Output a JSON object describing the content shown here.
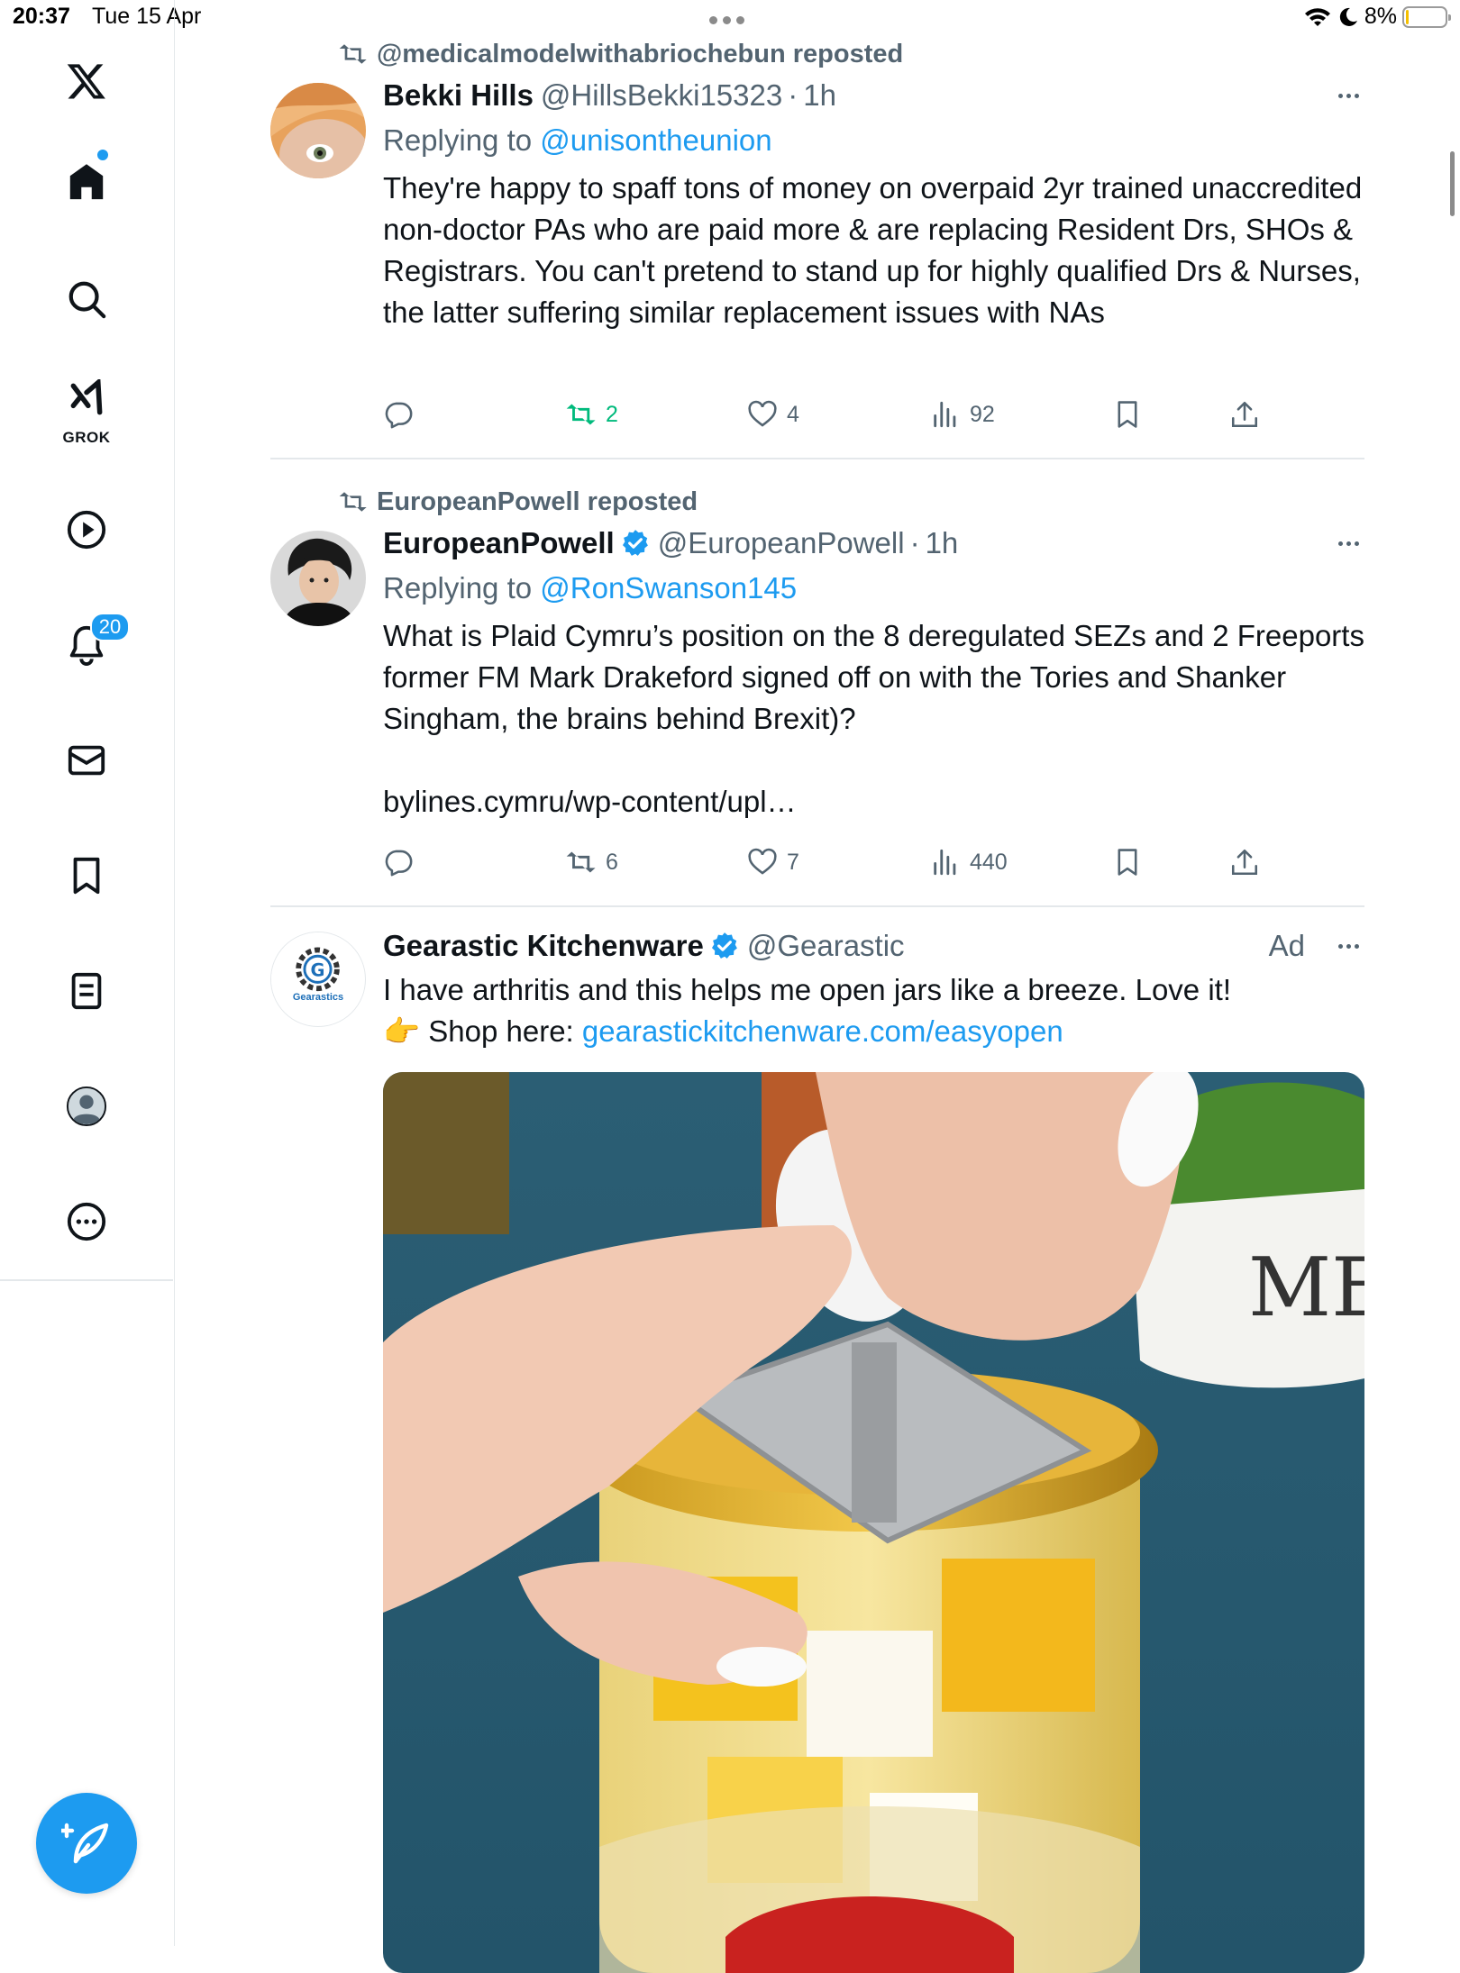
{
  "status_bar": {
    "time": "20:37",
    "date": "Tue 15 Apr",
    "battery_pct": "8%",
    "battery_level": 0.08
  },
  "sidebar": {
    "items": [
      {
        "id": "x-logo",
        "icon": "x-logo-icon"
      },
      {
        "id": "home",
        "icon": "home-icon",
        "has_dot": true
      },
      {
        "id": "search",
        "icon": "search-icon"
      },
      {
        "id": "grok",
        "icon": "grok-icon",
        "label": "GROK"
      },
      {
        "id": "video",
        "icon": "play-icon"
      },
      {
        "id": "notifications",
        "icon": "bell-icon",
        "badge": "20"
      },
      {
        "id": "messages",
        "icon": "mail-icon"
      },
      {
        "id": "bookmarks",
        "icon": "bookmark-icon"
      },
      {
        "id": "lists",
        "icon": "list-icon"
      },
      {
        "id": "profile",
        "icon": "profile-icon"
      },
      {
        "id": "more",
        "icon": "more-circle-icon"
      }
    ],
    "compose_icon": "compose-icon"
  },
  "colors": {
    "accent": "#1d9bf0",
    "text": "#0f1419",
    "secondary": "#536471",
    "retweet_green": "#00ba7c",
    "divider": "#e4e8eb"
  },
  "feed": {
    "posts": [
      {
        "reposted_by": "@medicalmodelwithabriochebun reposted",
        "name": "Bekki Hills",
        "handle": "@HillsBekki15323",
        "time": "1h",
        "replying_label": "Replying to ",
        "replying_to": "@unisontheunion",
        "text": "They're happy to spaff tons of money on overpaid 2yr trained unaccredited non-doctor PAs who are paid more & are replacing Resident Drs, SHOs & Registrars. You can't pretend to stand up for highly qualified Drs & Nurses, the latter suffering similar replacement issues with NAs",
        "replies": "",
        "retweets": "2",
        "likes": "4",
        "views": "92",
        "retweeted": true
      },
      {
        "reposted_by": "EuropeanPowell reposted",
        "name": "EuropeanPowell",
        "verified": true,
        "handle": "@EuropeanPowell",
        "time": "1h",
        "replying_label": "Replying to ",
        "replying_to": "@RonSwanson145",
        "text": "What is Plaid Cymru’s position on the 8 deregulated SEZs and 2 Freeports former FM Mark Drakeford signed off on with the Tories and Shanker Singham, the brains behind Brexit)?",
        "link": "bylines.cymru/wp-content/upl…",
        "replies": "",
        "retweets": "6",
        "likes": "7",
        "views": "440",
        "retweeted": false
      },
      {
        "name": "Gearastic Kitchenware",
        "verified": true,
        "handle": "@Gearastic",
        "ad_label": "Ad",
        "text_line1": "I have arthritis and this helps me open jars like a breeze. Love it!",
        "shop_emoji": "👉",
        "shop_label": " Shop here: ",
        "shop_link": "gearastickitchenware.com/easyopen",
        "avatar_text": "Gearastics"
      }
    ]
  }
}
